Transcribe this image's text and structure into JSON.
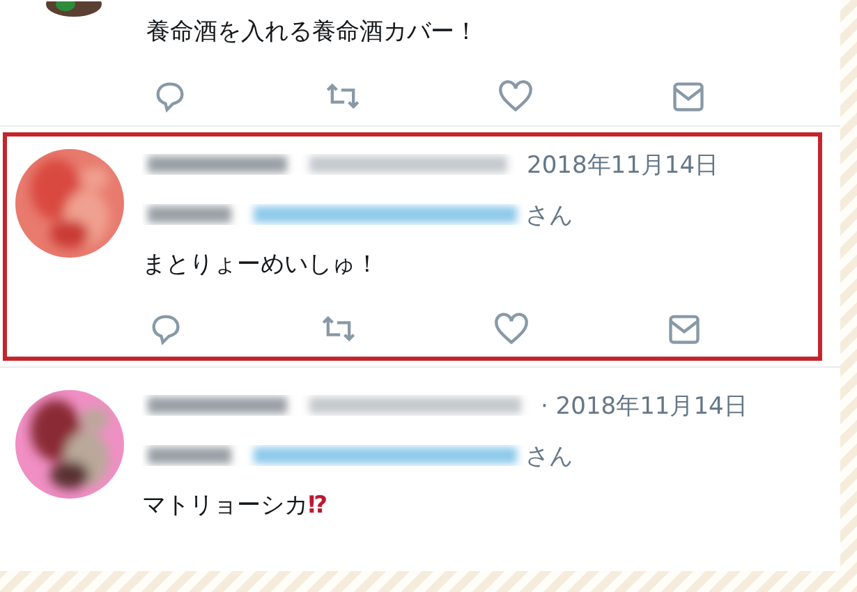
{
  "tweets": [
    {
      "highlighted": false,
      "text": "養命酒を入れる養命酒カバー！"
    },
    {
      "highlighted": true,
      "date": "2018年11月14日",
      "reply_suffix": "さん",
      "text": "まとりょーめいしゅ！"
    },
    {
      "highlighted": false,
      "date": "· 2018年11月14日",
      "reply_suffix": "さん",
      "text": "マトリョーシカ",
      "emoji": "⁉"
    }
  ]
}
